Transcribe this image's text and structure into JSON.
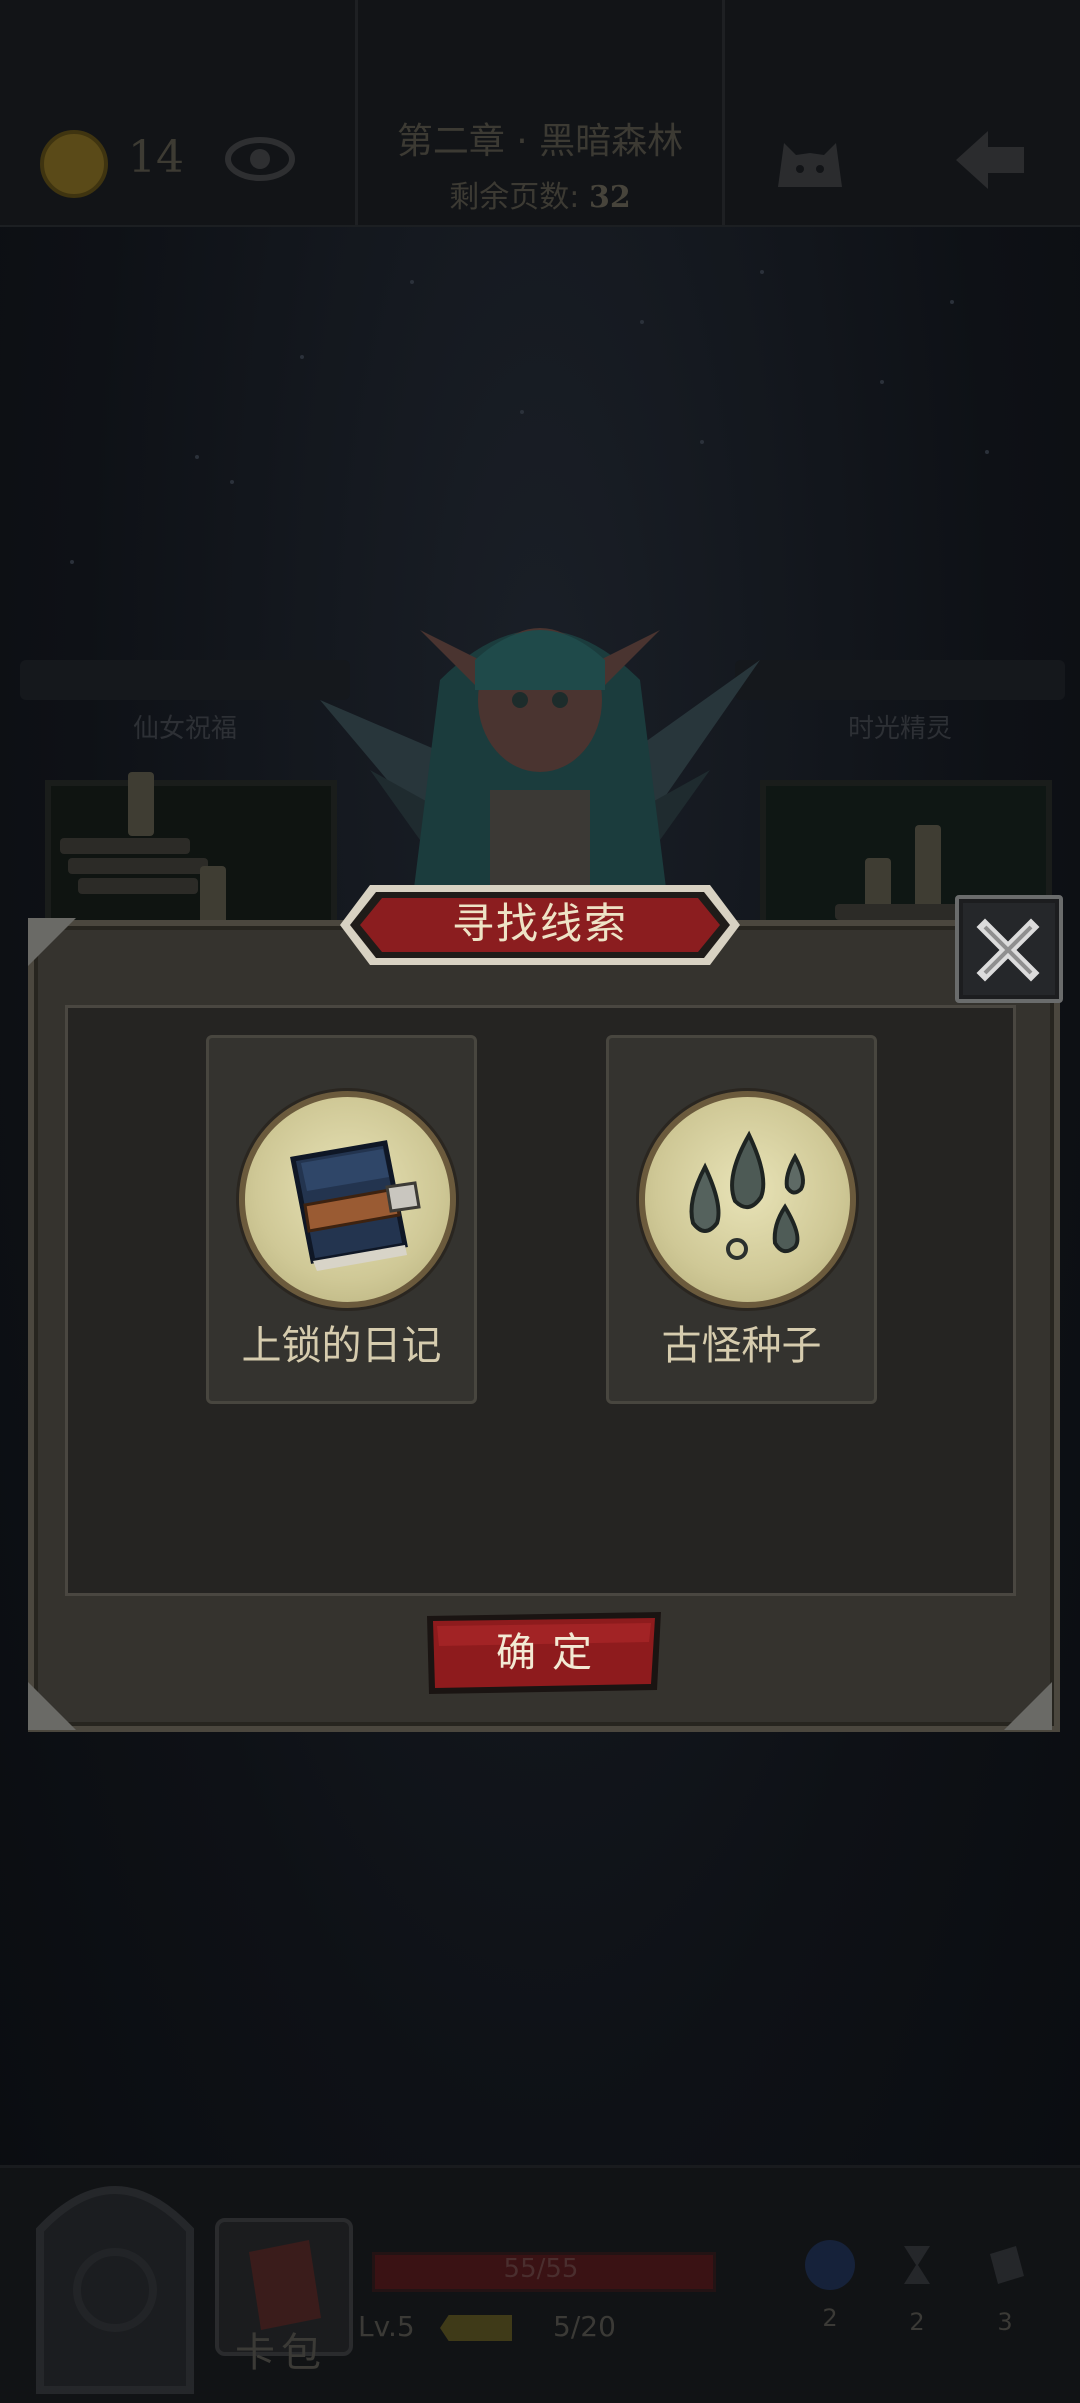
{
  "header": {
    "coins": "14",
    "chapter_title": "第二章 · 黑暗森林",
    "pages_label": "剩余页数:",
    "pages_value": "32"
  },
  "background": {
    "shrine_left_label": "仙女祝福",
    "shrine_right_label": "时光精灵"
  },
  "dialog": {
    "title": "寻找线索",
    "items": [
      {
        "name": "上锁的日记",
        "icon": "locked-diary-icon"
      },
      {
        "name": "古怪种子",
        "icon": "strange-seeds-icon"
      }
    ],
    "confirm_label": "确定"
  },
  "bottom": {
    "card_pack_label": "卡包",
    "hp_text": "55/55",
    "level": "Lv.5",
    "xp_text": "5/20",
    "resources": [
      {
        "icon": "bomb-icon",
        "count": "2"
      },
      {
        "icon": "hourglass-icon",
        "count": "2"
      },
      {
        "icon": "card-icon",
        "count": "3"
      }
    ]
  },
  "colors": {
    "banner_red": "#8b1d1f",
    "panel": "#35332e",
    "text_cream": "#eee3c6"
  }
}
